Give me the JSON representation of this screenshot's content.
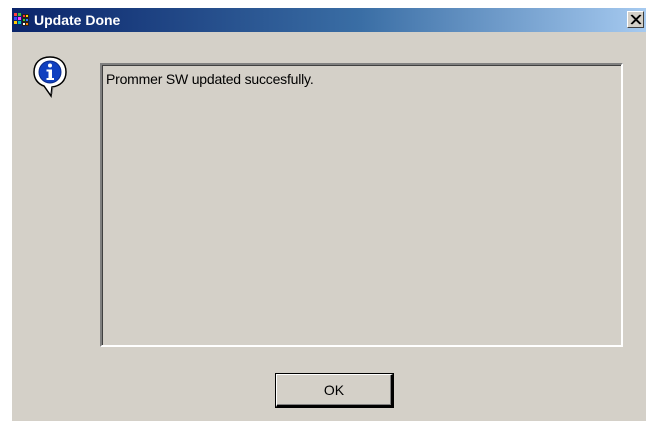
{
  "window": {
    "title": "Update Done",
    "app_icon": "app-icon",
    "close_icon": "close-icon"
  },
  "dialog": {
    "icon": "information-icon",
    "message": "Prommer SW updated succesfully.",
    "ok_label": "OK"
  },
  "colors": {
    "title_bar_start": "#0a246a",
    "title_bar_end": "#a6caf0",
    "face": "#d4d0c8"
  }
}
